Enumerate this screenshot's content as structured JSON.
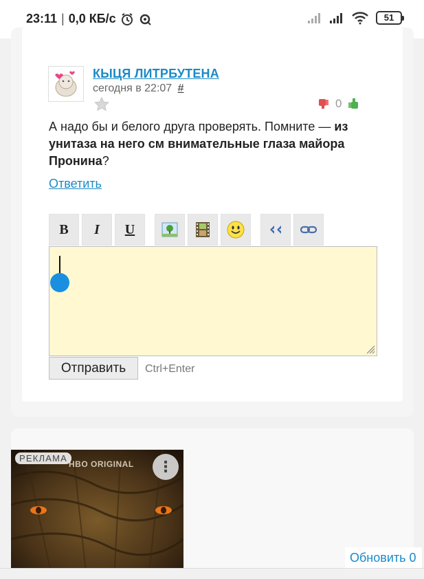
{
  "status_bar": {
    "time": "23:11",
    "separator": "|",
    "speed": "0,0 КБ/с",
    "battery": "51"
  },
  "comment": {
    "author": "КЫЦЯ ЛИТРБУТЕНА",
    "time": "сегодня в 22:07",
    "hash": "#",
    "vote_count": "0",
    "text_plain": "А надо бы и белого друга проверять. Помните — ",
    "text_bold": "из унитаза на него см внимательные глаза майора Пронина",
    "text_end": "?",
    "reply_label": "Ответить"
  },
  "editor": {
    "toolbar": {
      "bold": "B",
      "italic": "I",
      "underline": "U"
    },
    "submit_label": "Отправить",
    "hint": "Ctrl+Enter"
  },
  "ad": {
    "label": "РЕКЛАМА",
    "brand": "HBO ORIGINAL",
    "more": "⋮"
  },
  "refresh_label": "Обновить 0",
  "colors": {
    "link": "#1a8ac6",
    "editor_bg": "#fff8d1",
    "accent_dot": "#1a8fe0"
  }
}
